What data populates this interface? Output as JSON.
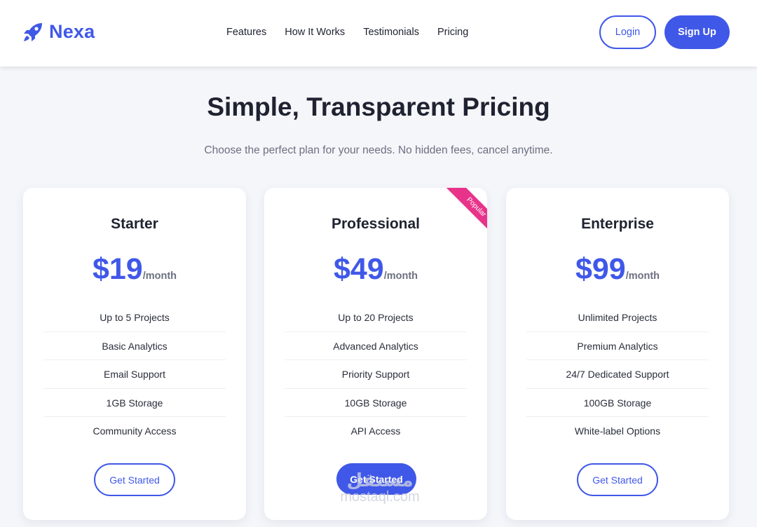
{
  "brand": {
    "name": "Nexa",
    "icon": "rocket-icon",
    "color": "#4058e8"
  },
  "nav": {
    "links": [
      "Features",
      "How It Works",
      "Testimonials",
      "Pricing"
    ],
    "login_label": "Login",
    "signup_label": "Sign Up"
  },
  "hero": {
    "title": "Simple, Transparent Pricing",
    "subtitle": "Choose the perfect plan for your needs. No hidden fees, cancel anytime."
  },
  "plans": [
    {
      "name": "Starter",
      "price": "$19",
      "period": "/month",
      "features": [
        "Up to 5 Projects",
        "Basic Analytics",
        "Email Support",
        "1GB Storage",
        "Community Access"
      ],
      "cta": "Get Started",
      "cta_style": "outline"
    },
    {
      "name": "Professional",
      "price": "$49",
      "period": "/month",
      "badge": "Popular",
      "features": [
        "Up to 20 Projects",
        "Advanced Analytics",
        "Priority Support",
        "10GB Storage",
        "API Access"
      ],
      "cta": "Get Started",
      "cta_style": "filled"
    },
    {
      "name": "Enterprise",
      "price": "$99",
      "period": "/month",
      "features": [
        "Unlimited Projects",
        "Premium Analytics",
        "24/7 Dedicated Support",
        "100GB Storage",
        "White-label Options"
      ],
      "cta": "Get Started",
      "cta_style": "outline"
    }
  ],
  "watermark": {
    "line1": "مستقل",
    "line2": "mostaql.com"
  },
  "colors": {
    "accent": "#4058e8",
    "badge": "#e8338a",
    "background": "#f5f6fa",
    "text": "#1f2230",
    "muted": "#6b7080"
  }
}
